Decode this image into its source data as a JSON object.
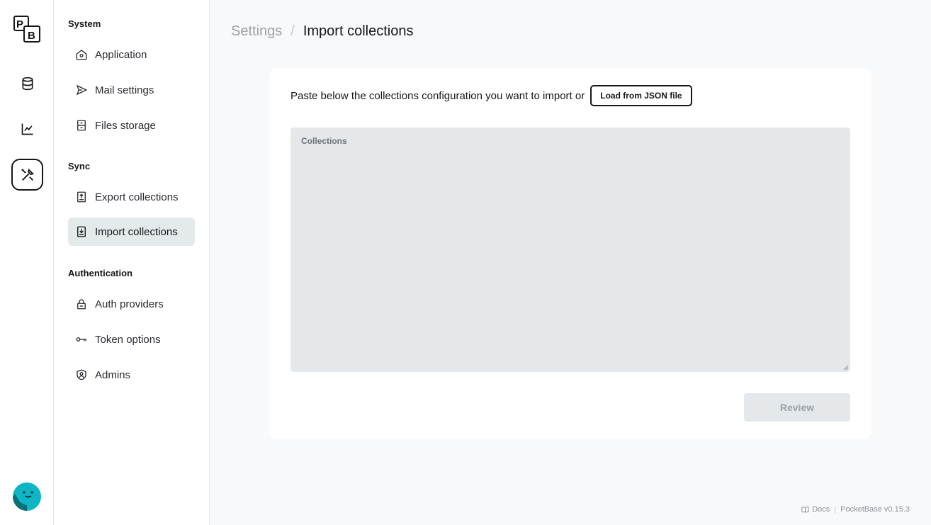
{
  "rail": {
    "logo_letters": [
      "P",
      "B"
    ],
    "items": [
      {
        "name": "collections",
        "icon": "database-icon",
        "active": false
      },
      {
        "name": "logs",
        "icon": "chart-line-icon",
        "active": false
      },
      {
        "name": "settings",
        "icon": "tools-icon",
        "active": true
      }
    ],
    "avatar_icon": "avatar-face-icon"
  },
  "sidebar": {
    "sections": [
      {
        "title": "System",
        "items": [
          {
            "label": "Application",
            "icon": "home-gear-icon"
          },
          {
            "label": "Mail settings",
            "icon": "send-plane-icon"
          },
          {
            "label": "Files storage",
            "icon": "archive-drawer-icon"
          }
        ]
      },
      {
        "title": "Sync",
        "items": [
          {
            "label": "Export collections",
            "icon": "upload-box-icon"
          },
          {
            "label": "Import collections",
            "icon": "download-box-icon",
            "active": true
          }
        ]
      },
      {
        "title": "Authentication",
        "items": [
          {
            "label": "Auth providers",
            "icon": "lock-icon"
          },
          {
            "label": "Token options",
            "icon": "key-icon"
          },
          {
            "label": "Admins",
            "icon": "shield-user-icon"
          }
        ]
      }
    ]
  },
  "breadcrumb": {
    "parent": "Settings",
    "separator": "/",
    "current": "Import collections"
  },
  "import_panel": {
    "intro_text": "Paste below the collections configuration you want to import or",
    "load_button": "Load from JSON file",
    "field_label": "Collections",
    "field_value": "",
    "review_button": "Review"
  },
  "footer": {
    "docs_label": "Docs",
    "separator": "|",
    "version": "PocketBase v0.15.3"
  },
  "colors": {
    "page_bg": "#f8f9fa",
    "active_bg": "#e4e9ec",
    "field_bg": "#e4e8ea",
    "avatar": "#0eb5c4"
  }
}
